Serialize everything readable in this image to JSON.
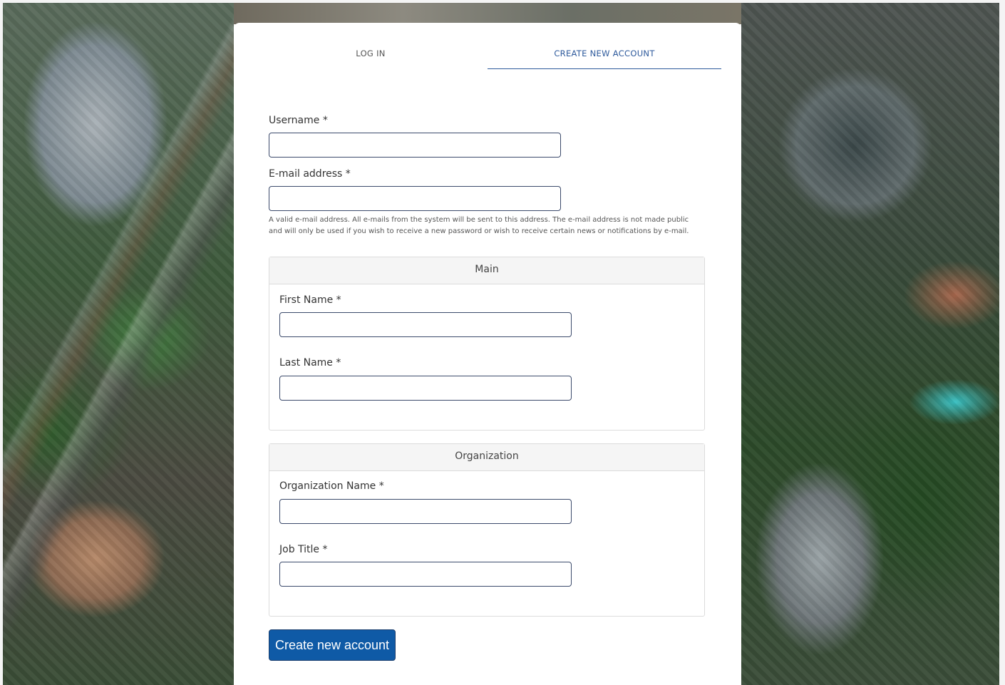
{
  "tabs": {
    "login_label": "LOG IN",
    "create_label": "CREATE NEW ACCOUNT",
    "active": "create"
  },
  "form": {
    "username": {
      "label": "Username *",
      "value": "",
      "placeholder": ""
    },
    "email": {
      "label": "E-mail address *",
      "value": "",
      "placeholder": "",
      "help": "A valid e-mail address. All e-mails from the system will be sent to this address. The e-mail address is not made public and will only be used if you wish to receive a new password or wish to receive certain news or notifications by e-mail."
    }
  },
  "main_fieldset": {
    "legend": "Main",
    "first_name": {
      "label": "First Name *",
      "value": ""
    },
    "last_name": {
      "label": "Last Name *",
      "value": ""
    }
  },
  "org_fieldset": {
    "legend": "Organization",
    "org_name": {
      "label": "Organization Name *",
      "value": ""
    },
    "job_title": {
      "label": "Job Title *",
      "value": ""
    }
  },
  "submit_label": "Create new account",
  "colors": {
    "accent": "#2e5a9c",
    "button": "#0f5aa6",
    "input_border": "#3b4a6b"
  }
}
